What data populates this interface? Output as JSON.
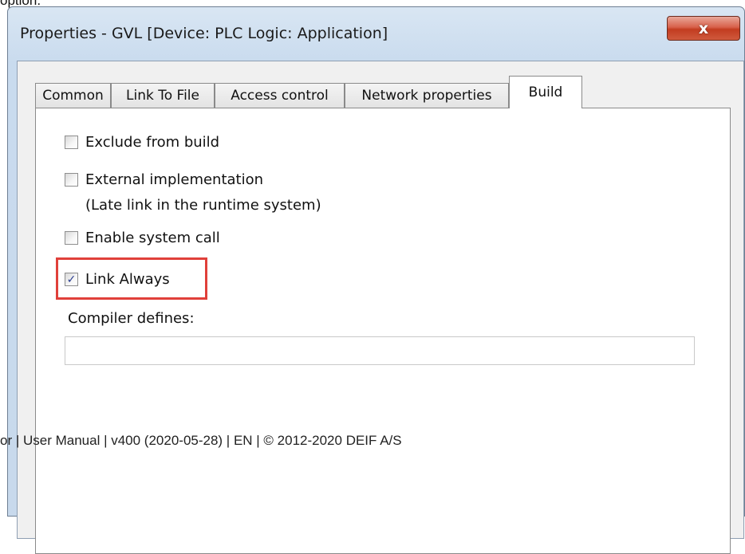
{
  "snippet": {
    "top_text": "option."
  },
  "dialog": {
    "title": "Properties - GVL [Device: PLC Logic: Application]",
    "close_label": "x",
    "tabs": [
      {
        "label": "Common"
      },
      {
        "label": "Link To File"
      },
      {
        "label": "Access control"
      },
      {
        "label": "Network properties"
      },
      {
        "label": "Build",
        "active": true
      }
    ],
    "build": {
      "exclude_label": "Exclude from build",
      "exclude_checked": false,
      "external_label": "External implementation",
      "external_sublabel": "(Late link in the runtime system)",
      "external_checked": false,
      "syscall_label": "Enable system call",
      "syscall_checked": false,
      "link_always_label": "Link Always",
      "link_always_checked": true,
      "check_mark": "✓",
      "compiler_defines_label": "Compiler defines:",
      "compiler_defines_value": ""
    }
  },
  "footer": {
    "text": "or | User Manual | v400 (2020-05-28) | EN | © 2012-2020 DEIF A/S"
  },
  "colors": {
    "highlight": "#e0403a",
    "close_button": "#c8432a",
    "frame": "#c9dbee"
  }
}
